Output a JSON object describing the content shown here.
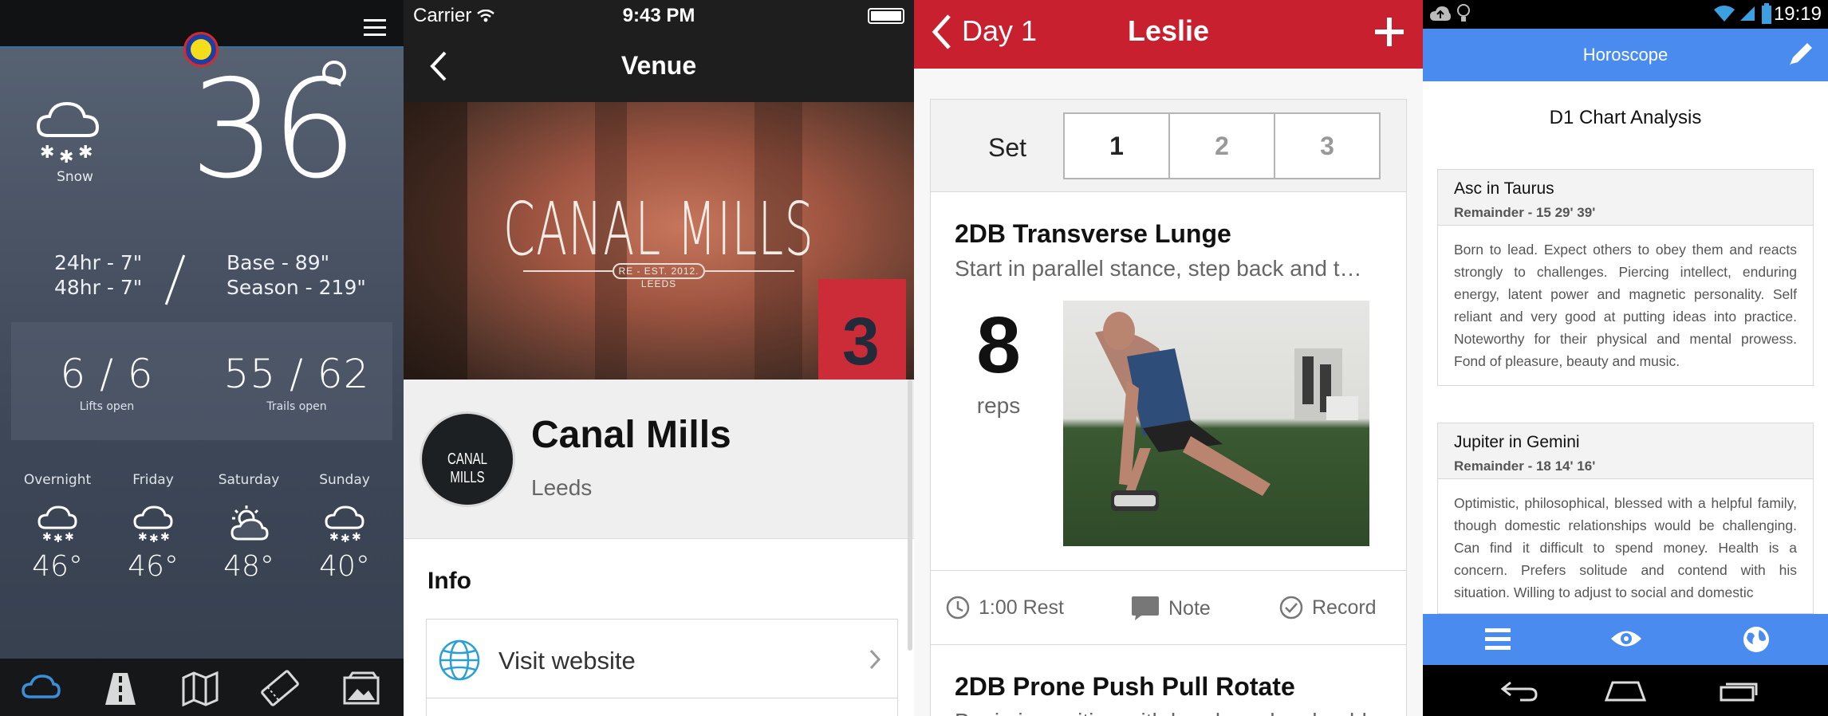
{
  "weather": {
    "current_condition": "Snow",
    "current_temp": "36",
    "snow_24hr": "24hr - 7\"",
    "snow_48hr": "48hr - 7\"",
    "base": "Base - 89\"",
    "season": "Season - 219\"",
    "lifts_value": "6 / 6",
    "lifts_label": "Lifts open",
    "trails_value": "55 / 62",
    "trails_label": "Trails open",
    "forecast": [
      {
        "day": "Overnight",
        "icon": "snow-icon",
        "temp": "46°"
      },
      {
        "day": "Friday",
        "icon": "snow-icon",
        "temp": "46°"
      },
      {
        "day": "Saturday",
        "icon": "partly-sunny-icon",
        "temp": "48°"
      },
      {
        "day": "Sunday",
        "icon": "snow-icon",
        "temp": "40°"
      }
    ],
    "nav": [
      "weather-cloud-icon",
      "road-icon",
      "map-icon",
      "ticket-icon",
      "photo-icon"
    ]
  },
  "venue": {
    "carrier": "Carrier",
    "time": "9:43 PM",
    "title": "Venue",
    "hero_title": "CANAL MILLS",
    "hero_sub": "RE - EST. 2012. LEEDS",
    "avatar_text": "CANAL MILLS",
    "name": "Canal Mills",
    "city": "Leeds",
    "info_heading": "Info",
    "visit_website": "Visit website"
  },
  "workout": {
    "back_label": "Day 1",
    "title": "Leslie",
    "set_label": "Set",
    "sets": [
      "1",
      "2",
      "3"
    ],
    "exercise_title": "2DB Transverse Lunge",
    "exercise_desc": "Start in parallel stance, step back and t…",
    "reps_value": "8",
    "reps_unit": "reps",
    "rest": "1:00 Rest",
    "note": "Note",
    "record": "Record",
    "next_exercise_title": "2DB Prone Push Pull Rotate",
    "next_exercise_desc": "Begin in position with hands under shoulders"
  },
  "horoscope": {
    "time": "19:19",
    "title": "Horoscope",
    "heading": "D1 Chart Analysis",
    "cards": [
      {
        "title": "Asc in Taurus",
        "sub": "Remainder - 15  29' 39'",
        "body": "Born to lead. Expect others to obey them and reacts strongly to challenges. Piercing intellect, enduring energy, latent power and magnetic personality. Self reliant and very good at putting ideas into practice. Noteworthy for their physical and mental prowess. Fond of pleasure, beauty and music."
      },
      {
        "title": "Jupiter in Gemini",
        "sub": "Remainder - 18  14' 16'",
        "body": "Optimistic, philosophical, blessed with a helpful family, though domestic relationships would be challenging. Can find it difficult to spend money. Health is a concern. Prefers solitude and contend with his situation. Willing to adjust to social and domestic"
      }
    ]
  },
  "colors": {
    "workout_red": "#c8202f",
    "horoscope_blue": "#4a8bf0",
    "venue_dark": "#1e1e1e"
  }
}
